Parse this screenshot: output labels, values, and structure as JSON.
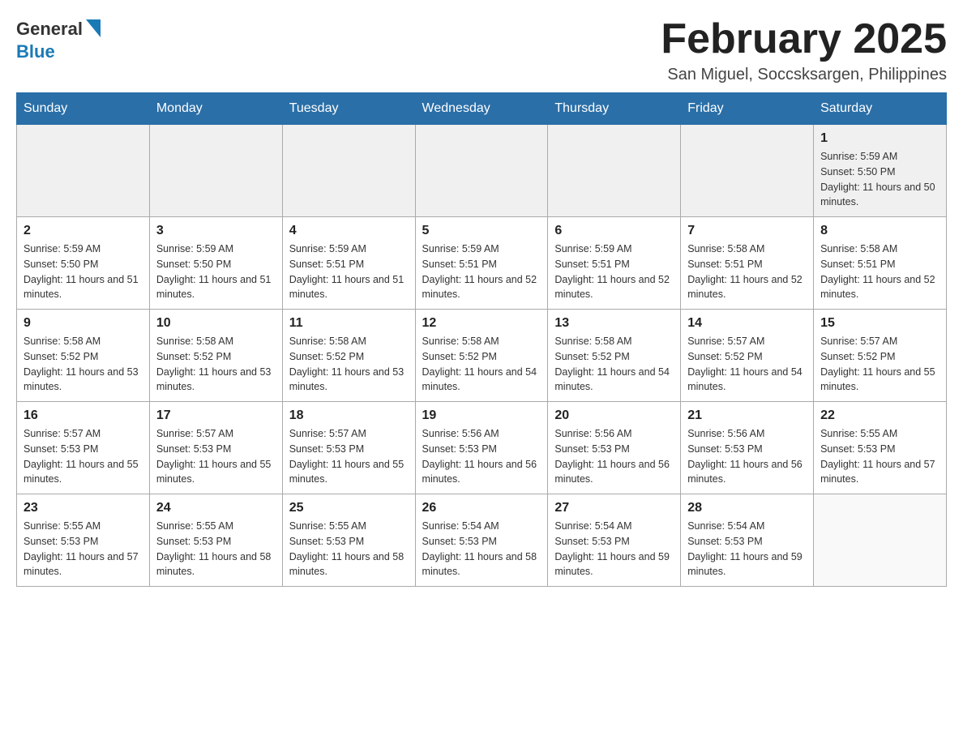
{
  "header": {
    "logo": {
      "general": "General",
      "blue": "Blue"
    },
    "title": "February 2025",
    "location": "San Miguel, Soccsksargen, Philippines"
  },
  "weekdays": [
    "Sunday",
    "Monday",
    "Tuesday",
    "Wednesday",
    "Thursday",
    "Friday",
    "Saturday"
  ],
  "weeks": [
    [
      {
        "day": "",
        "info": ""
      },
      {
        "day": "",
        "info": ""
      },
      {
        "day": "",
        "info": ""
      },
      {
        "day": "",
        "info": ""
      },
      {
        "day": "",
        "info": ""
      },
      {
        "day": "",
        "info": ""
      },
      {
        "day": "1",
        "info": "Sunrise: 5:59 AM\nSunset: 5:50 PM\nDaylight: 11 hours and 50 minutes."
      }
    ],
    [
      {
        "day": "2",
        "info": "Sunrise: 5:59 AM\nSunset: 5:50 PM\nDaylight: 11 hours and 51 minutes."
      },
      {
        "day": "3",
        "info": "Sunrise: 5:59 AM\nSunset: 5:50 PM\nDaylight: 11 hours and 51 minutes."
      },
      {
        "day": "4",
        "info": "Sunrise: 5:59 AM\nSunset: 5:51 PM\nDaylight: 11 hours and 51 minutes."
      },
      {
        "day": "5",
        "info": "Sunrise: 5:59 AM\nSunset: 5:51 PM\nDaylight: 11 hours and 52 minutes."
      },
      {
        "day": "6",
        "info": "Sunrise: 5:59 AM\nSunset: 5:51 PM\nDaylight: 11 hours and 52 minutes."
      },
      {
        "day": "7",
        "info": "Sunrise: 5:58 AM\nSunset: 5:51 PM\nDaylight: 11 hours and 52 minutes."
      },
      {
        "day": "8",
        "info": "Sunrise: 5:58 AM\nSunset: 5:51 PM\nDaylight: 11 hours and 52 minutes."
      }
    ],
    [
      {
        "day": "9",
        "info": "Sunrise: 5:58 AM\nSunset: 5:52 PM\nDaylight: 11 hours and 53 minutes."
      },
      {
        "day": "10",
        "info": "Sunrise: 5:58 AM\nSunset: 5:52 PM\nDaylight: 11 hours and 53 minutes."
      },
      {
        "day": "11",
        "info": "Sunrise: 5:58 AM\nSunset: 5:52 PM\nDaylight: 11 hours and 53 minutes."
      },
      {
        "day": "12",
        "info": "Sunrise: 5:58 AM\nSunset: 5:52 PM\nDaylight: 11 hours and 54 minutes."
      },
      {
        "day": "13",
        "info": "Sunrise: 5:58 AM\nSunset: 5:52 PM\nDaylight: 11 hours and 54 minutes."
      },
      {
        "day": "14",
        "info": "Sunrise: 5:57 AM\nSunset: 5:52 PM\nDaylight: 11 hours and 54 minutes."
      },
      {
        "day": "15",
        "info": "Sunrise: 5:57 AM\nSunset: 5:52 PM\nDaylight: 11 hours and 55 minutes."
      }
    ],
    [
      {
        "day": "16",
        "info": "Sunrise: 5:57 AM\nSunset: 5:53 PM\nDaylight: 11 hours and 55 minutes."
      },
      {
        "day": "17",
        "info": "Sunrise: 5:57 AM\nSunset: 5:53 PM\nDaylight: 11 hours and 55 minutes."
      },
      {
        "day": "18",
        "info": "Sunrise: 5:57 AM\nSunset: 5:53 PM\nDaylight: 11 hours and 55 minutes."
      },
      {
        "day": "19",
        "info": "Sunrise: 5:56 AM\nSunset: 5:53 PM\nDaylight: 11 hours and 56 minutes."
      },
      {
        "day": "20",
        "info": "Sunrise: 5:56 AM\nSunset: 5:53 PM\nDaylight: 11 hours and 56 minutes."
      },
      {
        "day": "21",
        "info": "Sunrise: 5:56 AM\nSunset: 5:53 PM\nDaylight: 11 hours and 56 minutes."
      },
      {
        "day": "22",
        "info": "Sunrise: 5:55 AM\nSunset: 5:53 PM\nDaylight: 11 hours and 57 minutes."
      }
    ],
    [
      {
        "day": "23",
        "info": "Sunrise: 5:55 AM\nSunset: 5:53 PM\nDaylight: 11 hours and 57 minutes."
      },
      {
        "day": "24",
        "info": "Sunrise: 5:55 AM\nSunset: 5:53 PM\nDaylight: 11 hours and 58 minutes."
      },
      {
        "day": "25",
        "info": "Sunrise: 5:55 AM\nSunset: 5:53 PM\nDaylight: 11 hours and 58 minutes."
      },
      {
        "day": "26",
        "info": "Sunrise: 5:54 AM\nSunset: 5:53 PM\nDaylight: 11 hours and 58 minutes."
      },
      {
        "day": "27",
        "info": "Sunrise: 5:54 AM\nSunset: 5:53 PM\nDaylight: 11 hours and 59 minutes."
      },
      {
        "day": "28",
        "info": "Sunrise: 5:54 AM\nSunset: 5:53 PM\nDaylight: 11 hours and 59 minutes."
      },
      {
        "day": "",
        "info": ""
      }
    ]
  ]
}
